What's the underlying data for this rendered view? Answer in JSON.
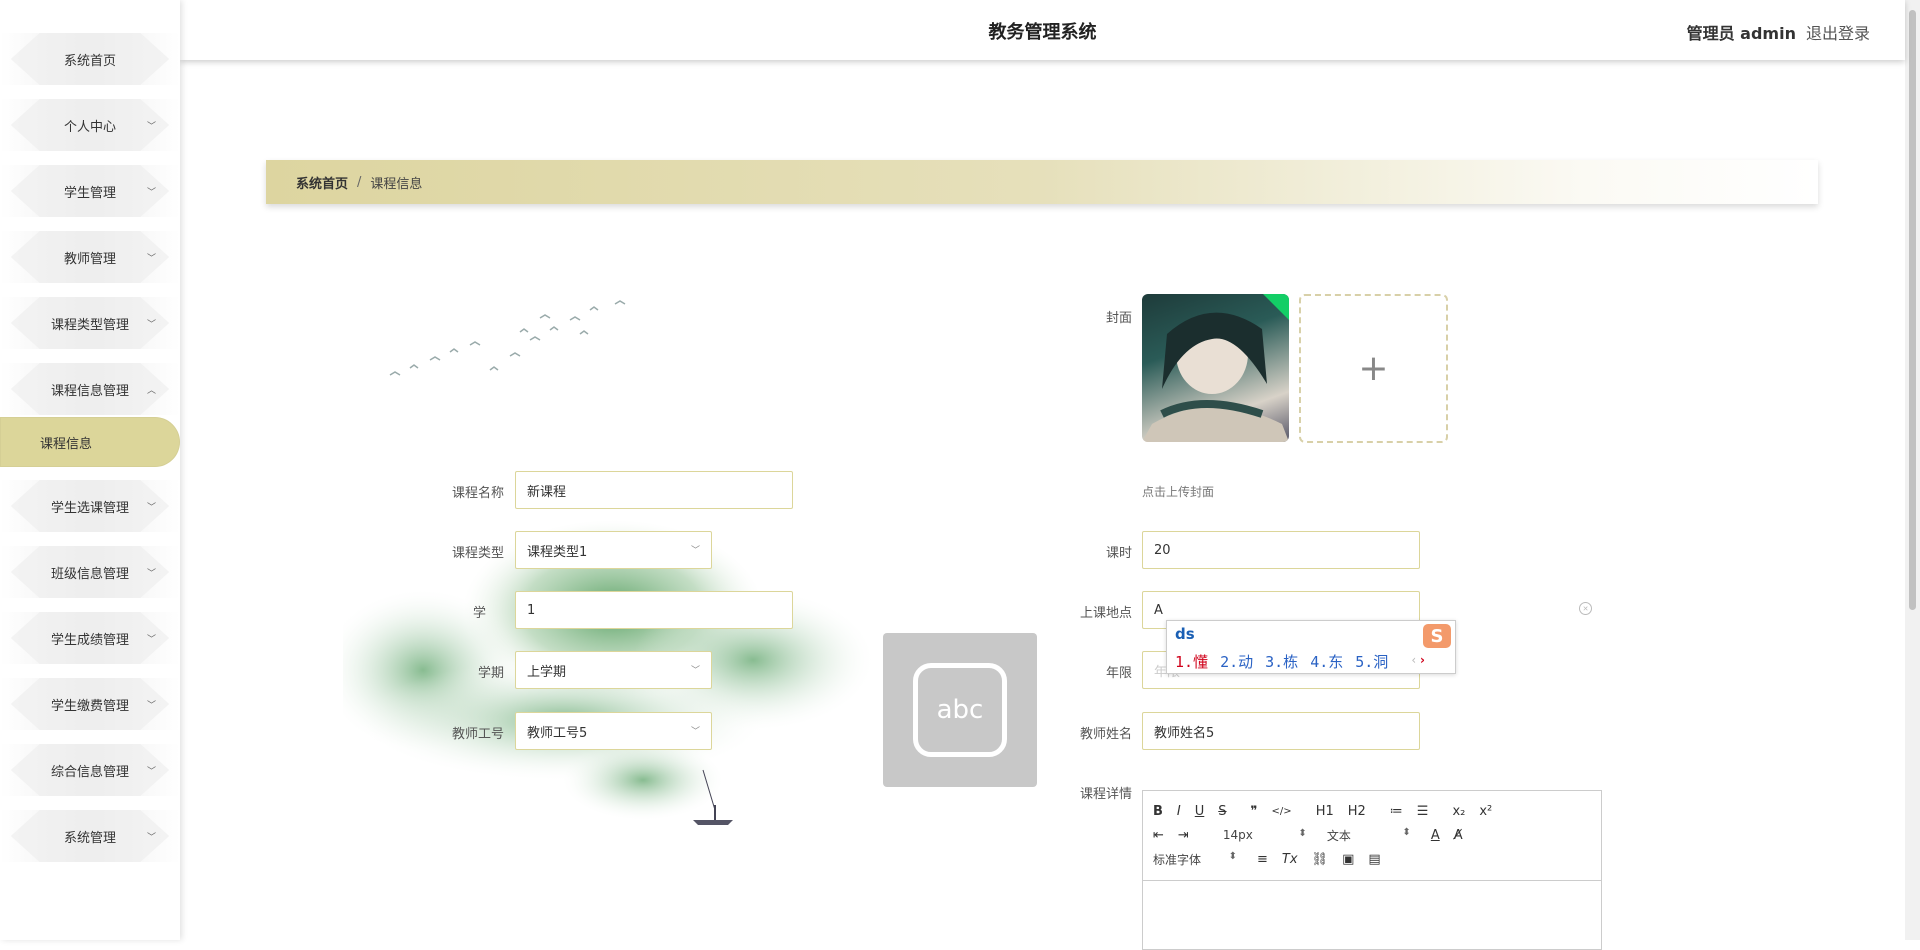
{
  "header": {
    "title": "教务管理系统",
    "user": "管理员 admin",
    "logout": "退出登录"
  },
  "sidebar": {
    "items": [
      {
        "label": "系统首页"
      },
      {
        "label": "个人中心"
      },
      {
        "label": "学生管理"
      },
      {
        "label": "教师管理"
      },
      {
        "label": "课程类型管理"
      },
      {
        "label": "课程信息管理"
      },
      {
        "label": "学生选课管理"
      },
      {
        "label": "班级信息管理"
      },
      {
        "label": "学生成绩管理"
      },
      {
        "label": "学生缴费管理"
      },
      {
        "label": "综合信息管理"
      },
      {
        "label": "系统管理"
      }
    ],
    "active_sub": "课程信息"
  },
  "breadcrumb": {
    "home": "系统首页",
    "separator": "/",
    "current": "课程信息"
  },
  "form": {
    "course_name": {
      "label": "课程名称",
      "value": "新课程"
    },
    "course_type": {
      "label": "课程类型",
      "value": "课程类型1"
    },
    "credit": {
      "label": "学",
      "value": "1"
    },
    "semester": {
      "label": "学期",
      "value": "上学期"
    },
    "teacher_no": {
      "label": "教师工号",
      "value": "教师工号5"
    },
    "cover": {
      "label": "封面",
      "tip": "点击上传封面"
    },
    "hours": {
      "label": "课时",
      "value": "20"
    },
    "location": {
      "label": "上课地点",
      "value": "A"
    },
    "year": {
      "label": "年限",
      "placeholder": "年限"
    },
    "teacher_name": {
      "label": "教师姓名",
      "value": "教师姓名5"
    },
    "detail": {
      "label": "课程详情"
    }
  },
  "ime": {
    "code": "ds",
    "candidates": [
      "1.懂",
      "2.动",
      "3.栋",
      "4.东",
      "5.洞"
    ],
    "logo": "S"
  },
  "float_key": {
    "label": "abc"
  },
  "editor": {
    "row1": [
      "B",
      "I",
      "U",
      "S",
      "❞",
      "</>",
      "H1",
      "H2",
      "≔",
      "☰",
      "x₂",
      "x²"
    ],
    "size": "14px",
    "format": "文本",
    "font": "标准字体"
  }
}
